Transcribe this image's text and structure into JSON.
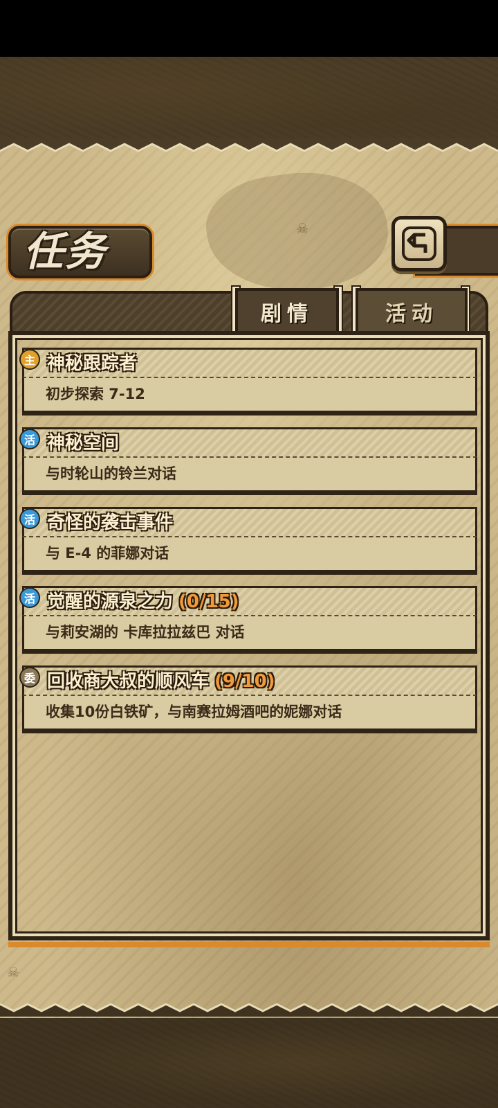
{
  "header": {
    "title": "任务",
    "back_icon": "back-arrow-icon"
  },
  "tabs": [
    {
      "label": "剧情",
      "active": true
    },
    {
      "label": "活动",
      "active": false
    }
  ],
  "quests": [
    {
      "icon_label": "主",
      "icon_color": "#e0a02a",
      "title": "神秘跟踪者",
      "progress": "",
      "desc": "初步探索 7-12"
    },
    {
      "icon_label": "活",
      "icon_color": "#3a9ad9",
      "title": "神秘空间",
      "progress": "",
      "desc": "与时轮山的铃兰对话"
    },
    {
      "icon_label": "活",
      "icon_color": "#3a9ad9",
      "title": "奇怪的袭击事件",
      "progress": "",
      "desc": "与 E-4 的菲娜对话"
    },
    {
      "icon_label": "活",
      "icon_color": "#3a9ad9",
      "title": "觉醒的源泉之力",
      "progress": "(0/15)",
      "desc": "与莉安湖的 卡库拉拉兹巴 对话"
    },
    {
      "icon_label": "委",
      "icon_color": "#8a7a5a",
      "title": "回收商大叔的顺风车",
      "progress": "(9/10)",
      "desc": "收集10份白铁矿，与南赛拉姆酒吧的妮娜对话"
    }
  ]
}
